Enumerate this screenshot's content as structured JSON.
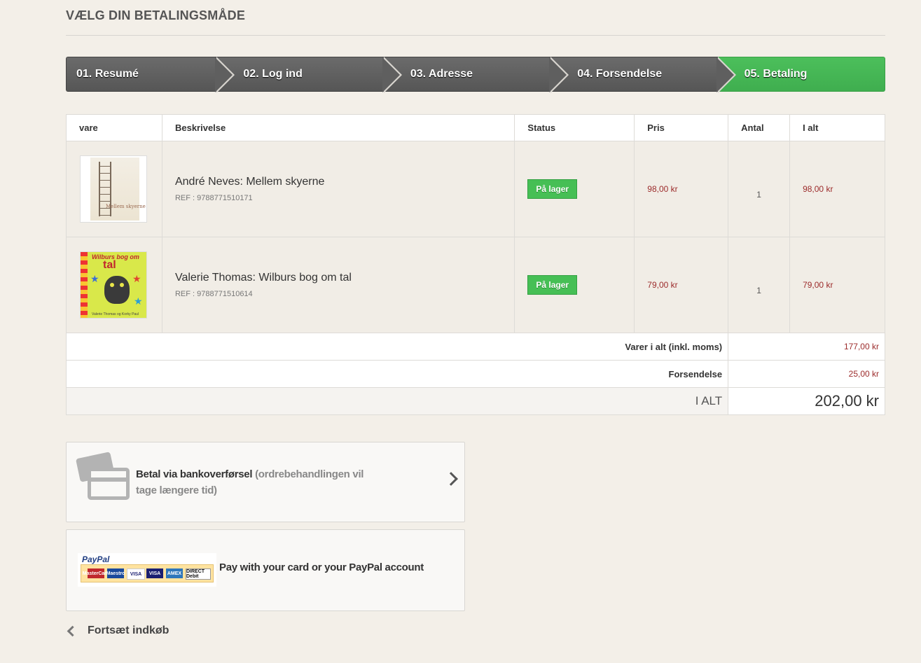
{
  "page": {
    "title": "Vælg din betalingsmåde"
  },
  "steps": [
    {
      "label": "01. Resumé"
    },
    {
      "label": "02. Log ind"
    },
    {
      "label": "03. Adresse"
    },
    {
      "label": "04. Forsendelse"
    },
    {
      "label": "05. Betaling"
    }
  ],
  "cart": {
    "headers": [
      "vare",
      "Beskrivelse",
      "Status",
      "Pris",
      "Antal",
      "I alt"
    ],
    "items": [
      {
        "name": "André Neves: Mellem skyerne",
        "ref": "REF : 9788771510171",
        "status": "På lager",
        "price": "98,00 kr",
        "qty": "1",
        "total": "98,00 kr",
        "cover_text": "Mellem skyerne"
      },
      {
        "name": "Valerie Thomas: Wilburs bog om tal",
        "ref": "REF : 9788771510614",
        "status": "På lager",
        "price": "79,00 kr",
        "qty": "1",
        "total": "79,00 kr",
        "cover_title": "Wilburs bog om",
        "cover_title2": "tal",
        "cover_authors": "Valerie Thomas og Korky Paul"
      }
    ],
    "summary": {
      "subtotal_label": "Varer i alt (inkl. moms)",
      "subtotal_value": "177,00 kr",
      "shipping_label": "Forsendelse",
      "shipping_value": "25,00 kr",
      "grand_label": "I ALT",
      "grand_value": "202,00 kr"
    }
  },
  "payment": {
    "bank": {
      "label": "Betal via bankoverførsel",
      "note": "(ordrebehandlingen vil tage længere tid)",
      "icon": "credit-card-icon"
    },
    "paypal": {
      "logo_text": "PayPal",
      "label": "Pay with your card or your PayPal account",
      "cards": [
        "MasterCard",
        "Maestro",
        "VISA",
        "VISA",
        "AMEX",
        "DIRECT Debit"
      ]
    }
  },
  "continue_shopping": "Fortsæt indkøb",
  "colors": {
    "active_step": "#46b455",
    "price": "#9c2b2b",
    "badge": "#46bf55"
  }
}
